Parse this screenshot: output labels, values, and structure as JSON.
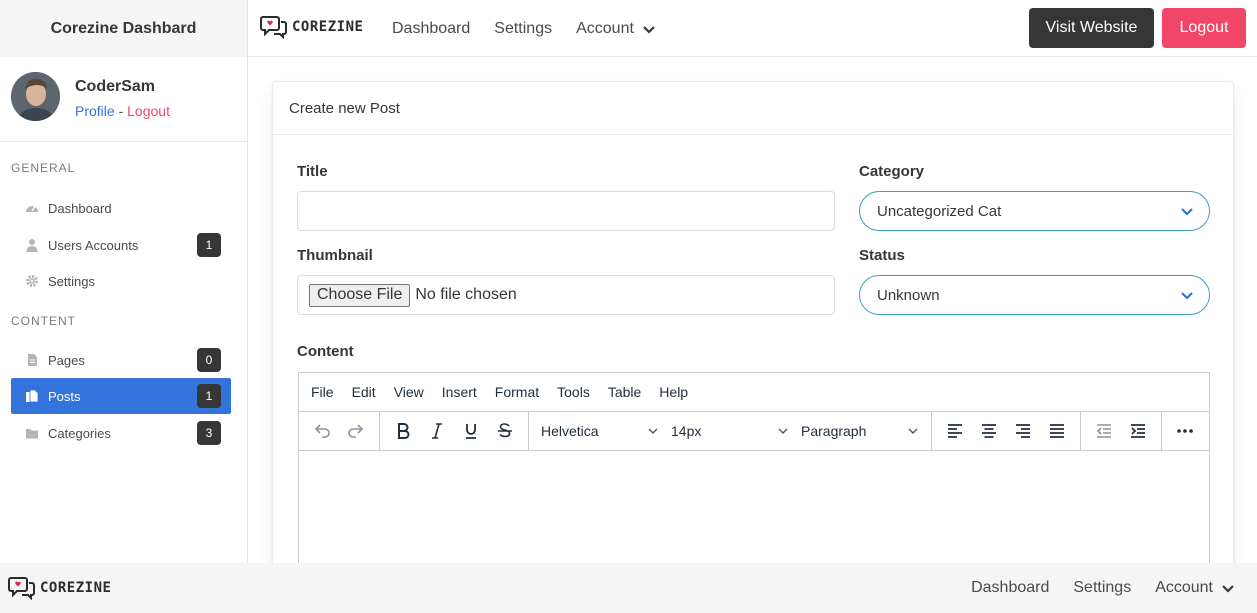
{
  "topbar": {
    "brand_title": "Corezine Dashbard",
    "logo_text": "COREZINE",
    "nav": [
      "Dashboard",
      "Settings",
      "Account"
    ],
    "visit_label": "Visit Website",
    "logout_label": "Logout"
  },
  "sidebar": {
    "user": {
      "name": "CoderSam",
      "profile_link": "Profile",
      "separator": "-",
      "logout_link": "Logout"
    },
    "general_label": "General",
    "general_items": [
      {
        "label": "Dashboard",
        "icon": "gauge-icon",
        "badge": ""
      },
      {
        "label": "Users Accounts",
        "icon": "user-icon",
        "badge": "1"
      },
      {
        "label": "Settings",
        "icon": "gear-icon",
        "badge": ""
      }
    ],
    "content_label": "Content",
    "content_items": [
      {
        "label": "Pages",
        "icon": "file-icon",
        "badge": "0"
      },
      {
        "label": "Posts",
        "icon": "files-icon",
        "badge": "1",
        "active": true
      },
      {
        "label": "Categories",
        "icon": "folder-icon",
        "badge": "3"
      }
    ]
  },
  "form": {
    "card_title": "Create new Post",
    "title_label": "Title",
    "title_value": "",
    "category_label": "Category",
    "category_value": "Uncategorized Cat",
    "thumbnail_label": "Thumbnail",
    "file_button": "Choose File",
    "file_status": "No file chosen",
    "status_label": "Status",
    "status_value": "Unknown",
    "content_label": "Content"
  },
  "editor": {
    "menu": [
      "File",
      "Edit",
      "View",
      "Insert",
      "Format",
      "Tools",
      "Table",
      "Help"
    ],
    "font_family": "Helvetica",
    "font_size": "14px",
    "block_format": "Paragraph"
  },
  "footer": {
    "logo_text": "COREZINE",
    "nav": [
      "Dashboard",
      "Settings",
      "Account"
    ]
  },
  "colors": {
    "primary": "#3273dc",
    "danger": "#f14668",
    "dark": "#363636",
    "select_border": "#3aa1b8"
  }
}
